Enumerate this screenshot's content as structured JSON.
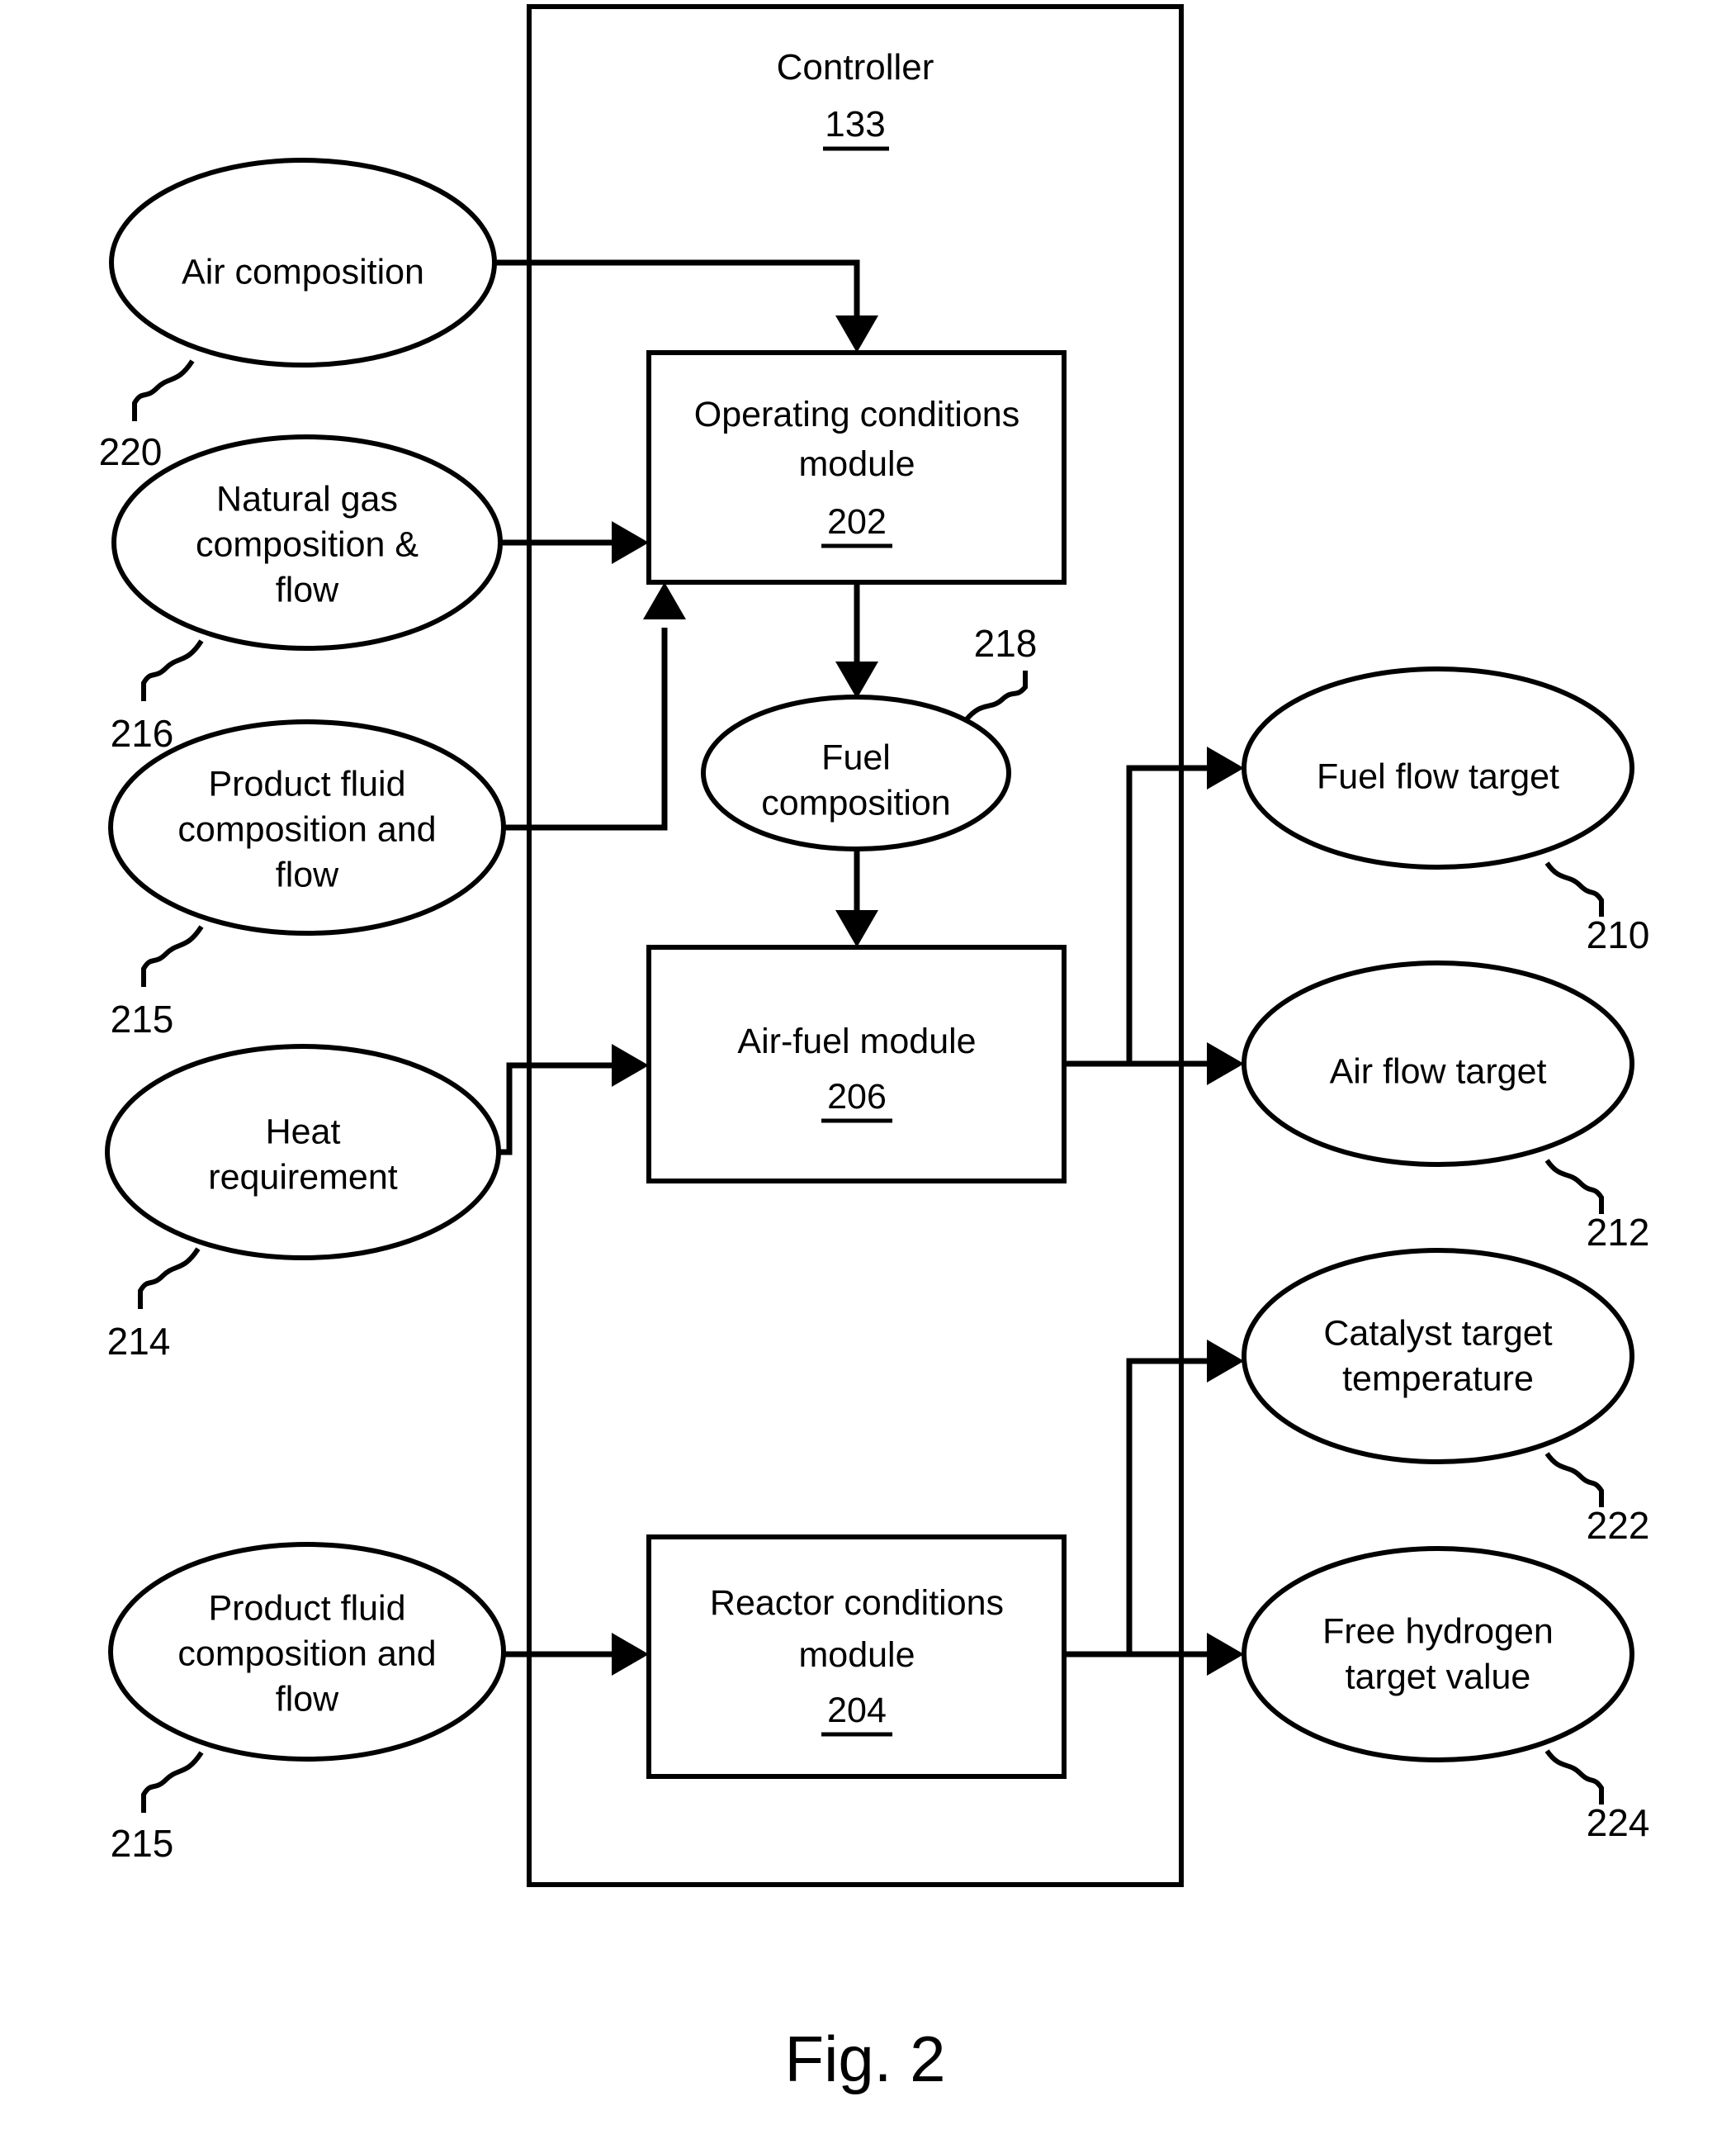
{
  "figure": {
    "caption": "Fig. 2",
    "container": {
      "title": "Controller",
      "ref": "133"
    }
  },
  "inputs": [
    {
      "label": "Air composition",
      "ref": "220"
    },
    {
      "label_line1": "Natural gas",
      "label_line2": "composition &",
      "label_line3": "flow",
      "ref": "216"
    },
    {
      "label_line1": "Product fluid",
      "label_line2": "composition and",
      "label_line3": "flow",
      "ref": "215"
    },
    {
      "label_line1": "Heat",
      "label_line2": "requirement",
      "ref": "214"
    },
    {
      "label_line1": "Product fluid",
      "label_line2": "composition and",
      "label_line3": "flow",
      "ref": "215"
    }
  ],
  "modules": [
    {
      "name_line1": "Operating conditions",
      "name_line2": "module",
      "ref": "202"
    },
    {
      "name_line1": "Air-fuel module",
      "name_line2": "",
      "ref": "206"
    },
    {
      "name_line1": "Reactor conditions",
      "name_line2": "module",
      "ref": "204"
    }
  ],
  "intermediate": [
    {
      "label_line1": "Fuel",
      "label_line2": "composition",
      "ref": "218"
    }
  ],
  "outputs": [
    {
      "label_line1": "Fuel flow target",
      "label_line2": "",
      "ref": "210"
    },
    {
      "label_line1": "Air flow target",
      "label_line2": "",
      "ref": "212"
    },
    {
      "label_line1": "Catalyst target",
      "label_line2": "temperature",
      "ref": "222"
    },
    {
      "label_line1": "Free hydrogen",
      "label_line2": "target value",
      "ref": "224"
    }
  ],
  "colors": {
    "stroke": "#000000",
    "fill": "#ffffff",
    "text": "#000000"
  }
}
